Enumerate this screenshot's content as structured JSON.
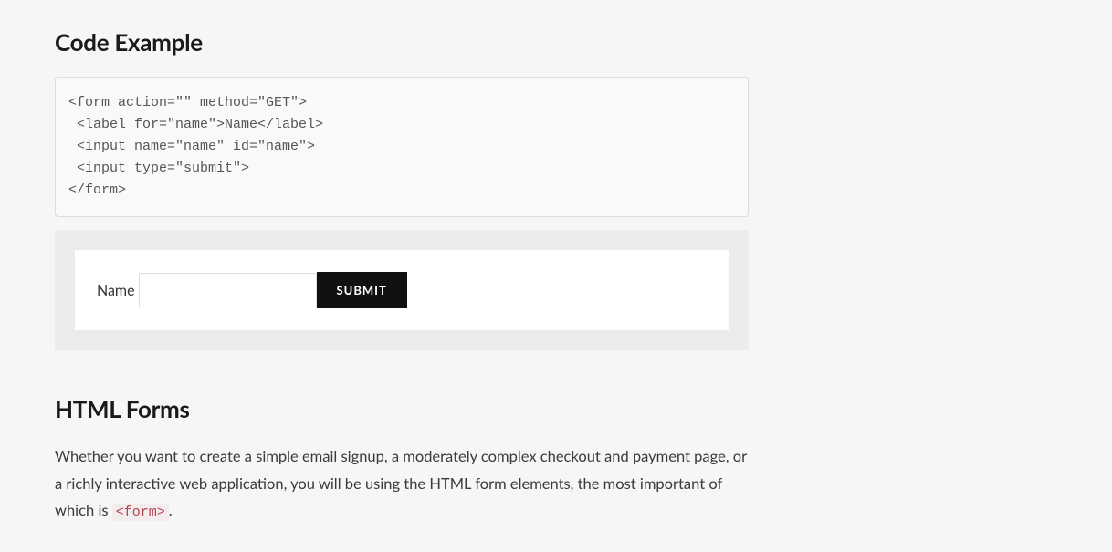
{
  "heading_code_example": "Code Example",
  "code_lines": "<form action=\"\" method=\"GET\">\n <label for=\"name\">Name</label>\n <input name=\"name\" id=\"name\">\n <input type=\"submit\">\n</form>",
  "form_preview": {
    "label": "Name",
    "submit_label": "SUBMIT"
  },
  "heading_html_forms": "HTML Forms",
  "paragraph_parts": {
    "pre": "Whether you want to create a simple email signup, a moderately complex checkout and payment page, or a richly interactive web application, you will be using the HTML form elements, the most important of which is ",
    "code": "<form>",
    "post": "."
  }
}
